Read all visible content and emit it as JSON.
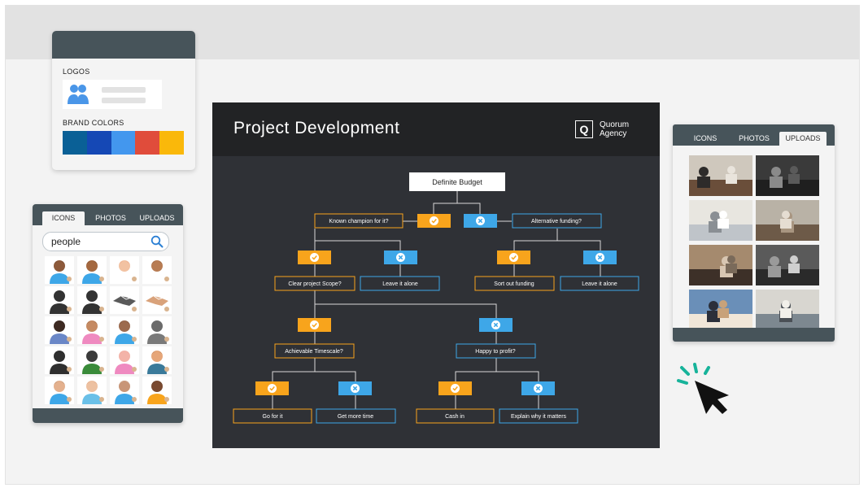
{
  "brand_kit": {
    "logos_label": "LOGOS",
    "brand_colors_label": "BRAND COLORS",
    "colors": [
      "#0a6096",
      "#1548b5",
      "#4397ee",
      "#e04c3b",
      "#fab80a"
    ]
  },
  "icons_panel": {
    "tabs": [
      "ICONS",
      "PHOTOS",
      "UPLOADS"
    ],
    "active_tab": "ICONS",
    "search_value": "people"
  },
  "photos_panel": {
    "tabs": [
      "ICONS",
      "PHOTOS",
      "UPLOADS"
    ],
    "active_tab": "UPLOADS"
  },
  "flowchart": {
    "title": "Project Development",
    "brand_mark": "Q",
    "brand_line1": "Quorum",
    "brand_line2": "Agency",
    "nodes": {
      "root": "Definite Budget",
      "champion": "Known champion for it?",
      "funding": "Alternative funding?",
      "scope": "Clear project Scope?",
      "leave1": "Leave it alone",
      "sort": "Sort out funding",
      "leave2": "Leave it alone",
      "timescale": "Achievable Timescale?",
      "profit": "Happy to profit?",
      "goforit": "Go for it",
      "moretime": "Get more time",
      "cashin": "Cash in",
      "explain": "Explain why it matters"
    },
    "colors": {
      "yes": "#f8a41c",
      "no": "#3ea7e8",
      "root_fill": "#ffffff",
      "bg": "#2f3136",
      "header": "#222325"
    }
  },
  "cursor": {
    "accent": "#17b39a"
  }
}
